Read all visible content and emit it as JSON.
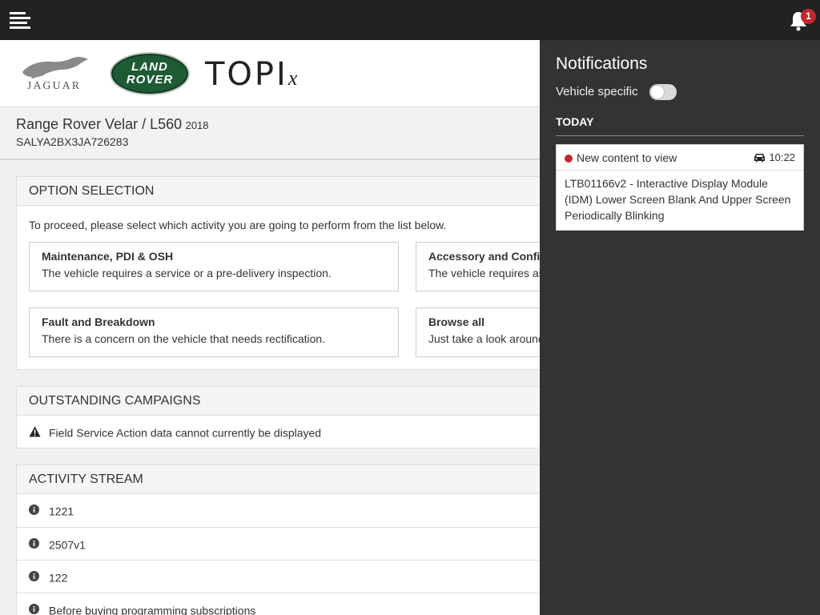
{
  "brand": {
    "jaguar": "JAGUAR",
    "land_rover_line1": "LAND",
    "land_rover_line2": "ROVER",
    "topix": "TOPI",
    "topix_x": "x"
  },
  "topbar": {
    "notification_count": "1"
  },
  "vehicle": {
    "name": "Range Rover Velar / L560",
    "year": "2018",
    "vin": "SALYA2BX3JA726283"
  },
  "option_selection": {
    "title": "OPTION SELECTION",
    "intro": "To proceed, please select which activity you are going to perform from the list below.",
    "cards": [
      {
        "title": "Maintenance, PDI & OSH",
        "desc": "The vehicle requires a service or a pre-delivery inspection."
      },
      {
        "title": "Accessory and Configuration",
        "desc": "The vehicle requires an accessory fitment or configuration."
      },
      {
        "title": "Fault and Breakdown",
        "desc": "There is a concern on the vehicle that needs rectification."
      },
      {
        "title": "Browse all",
        "desc": "Just take a look around."
      }
    ]
  },
  "campaigns": {
    "title": "OUTSTANDING CAMPAIGNS",
    "message": "Field Service Action data cannot currently be displayed"
  },
  "activity": {
    "title": "ACTIVITY STREAM",
    "items": [
      "1221",
      "2507v1",
      "122",
      "Before buying programming subscriptions"
    ]
  },
  "notifications": {
    "title": "Notifications",
    "vehicle_specific_label": "Vehicle specific",
    "vehicle_specific_on": false,
    "section": "TODAY",
    "items": [
      {
        "status": "New content to view",
        "time": "10:22",
        "body": "LTB01166v2 - Interactive Display Module (IDM) Lower Screen Blank And Upper Screen Periodically Blinking"
      }
    ]
  }
}
